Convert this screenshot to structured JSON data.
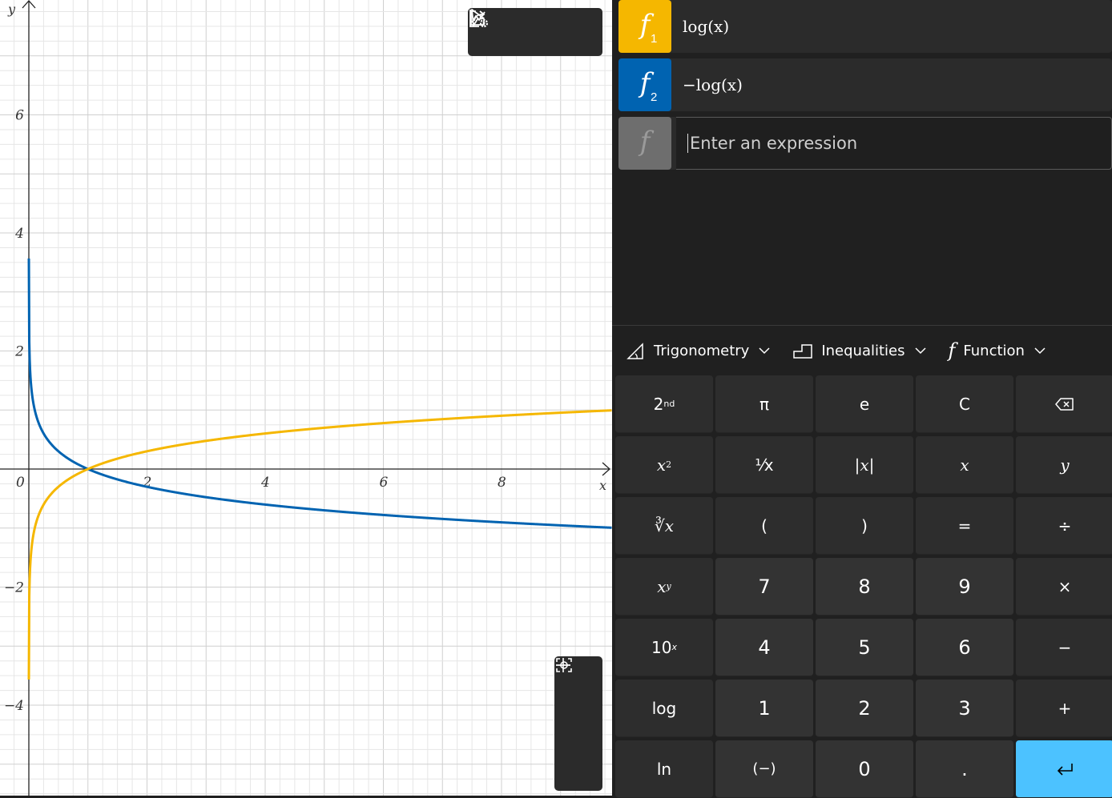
{
  "graph": {
    "x_axis_label": "x",
    "y_axis_label": "y",
    "x_ticks": [
      "0",
      "2",
      "4",
      "6",
      "8"
    ],
    "y_ticks": [
      "6",
      "4",
      "2",
      "−2",
      "−4"
    ],
    "curve_colors": {
      "f1": "#f5b700",
      "f2": "#0063b1"
    },
    "toolbar": [
      "select-tool-icon",
      "share-icon",
      "graph-settings-icon"
    ],
    "zoom": [
      "zoom-in-icon",
      "zoom-out-icon",
      "fit-view-icon"
    ]
  },
  "functions": [
    {
      "badge": "f",
      "subscript": "1",
      "expression": "log(x)",
      "color": "#f5b700"
    },
    {
      "badge": "f",
      "subscript": "2",
      "expression": "−log(x)",
      "color": "#0063b1"
    }
  ],
  "new_function": {
    "badge": "f",
    "placeholder": "Enter an expression"
  },
  "categories": {
    "trig": "Trigonometry",
    "ineq": "Inequalities",
    "func": "Function"
  },
  "keys": {
    "second": "2",
    "second_sup": "nd",
    "pi": "π",
    "e": "e",
    "clear": "C",
    "x_sq": "x",
    "x_sq_sup": "2",
    "recip": "⅟x",
    "abs": "|x|",
    "x": "x",
    "y": "y",
    "root": "∛x",
    "lparen": "(",
    "rparen": ")",
    "equals": "=",
    "divide": "÷",
    "x_pow": "x",
    "x_pow_sup": "y",
    "seven": "7",
    "eight": "8",
    "nine": "9",
    "times": "×",
    "ten_pow": "10",
    "ten_pow_sup": "x",
    "four": "4",
    "five": "5",
    "six": "6",
    "minus": "−",
    "log": "log",
    "one": "1",
    "two": "2",
    "three": "3",
    "plus": "+",
    "ln": "ln",
    "negate": "(−)",
    "zero": "0",
    "dot": "."
  }
}
